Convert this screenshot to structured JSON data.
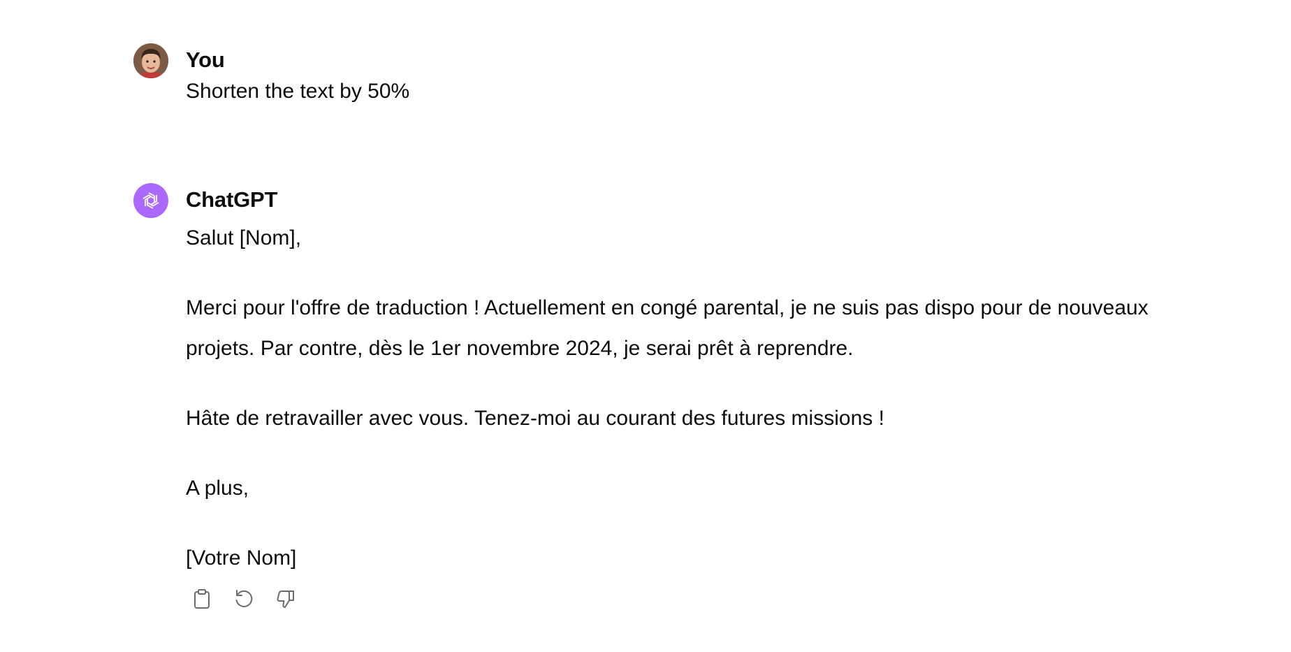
{
  "conversation": {
    "user_message": {
      "author": "You",
      "text": "Shorten the text by 50%"
    },
    "assistant_message": {
      "author": "ChatGPT",
      "paragraphs": [
        "Salut [Nom],",
        "Merci pour l'offre de traduction ! Actuellement en congé parental, je ne suis pas dispo pour de nouveaux projets. Par contre, dès le 1er novembre 2024, je serai prêt à reprendre.",
        "Hâte de retravailler avec vous. Tenez-moi au courant des futures missions !",
        "A plus,",
        "[Votre Nom]"
      ],
      "actions": [
        {
          "name": "copy",
          "icon": "clipboard-icon"
        },
        {
          "name": "regenerate",
          "icon": "regenerate-icon"
        },
        {
          "name": "bad-response",
          "icon": "thumbs-down-icon"
        }
      ]
    }
  },
  "colors": {
    "text": "#0d0d0d",
    "gpt_avatar_bg": "#ab68ff",
    "icon_gray": "#6b6b6b"
  }
}
